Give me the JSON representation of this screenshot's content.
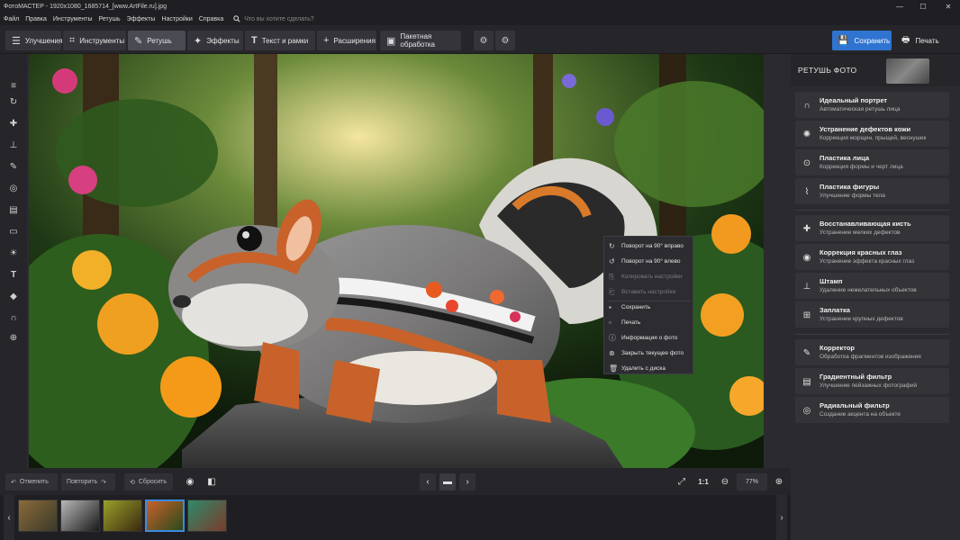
{
  "titlebar": {
    "title": "ФотоМАСТЕР - 1920x1080_1685714_[www.ArtFile.ru].jpg",
    "minimize": "—",
    "maximize": "☐",
    "close": "✕"
  },
  "menubar": {
    "items": [
      "Файл",
      "Правка",
      "Инструменты",
      "Ретушь",
      "Эффекты",
      "Настройки",
      "Справка"
    ],
    "search_placeholder": "Что вы хотите сделать?"
  },
  "toolbar": {
    "tabs": [
      {
        "label": "Улучшения",
        "icon": "sliders-icon"
      },
      {
        "label": "Инструменты",
        "icon": "crop-icon"
      },
      {
        "label": "Ретушь",
        "icon": "brush-icon"
      },
      {
        "label": "Эффекты",
        "icon": "sparkle-icon"
      },
      {
        "label": "Текст и рамки",
        "icon": "text-icon"
      },
      {
        "label": "Расширения",
        "icon": "plus-icon"
      },
      {
        "label": "Пакетная обработка",
        "icon": "batch-icon"
      }
    ],
    "active_tab": "Ретушь",
    "save_label": "Сохранить",
    "print_label": "Печать",
    "accent_color": "#2f74d0"
  },
  "context_menu": {
    "items": [
      {
        "label": "Поворот на 90° вправо",
        "icon": "rotate-right-icon",
        "enabled": true
      },
      {
        "label": "Поворот на 90° влево",
        "icon": "rotate-left-icon",
        "enabled": true
      },
      {
        "label": "Копировать настройки",
        "icon": "copy-icon",
        "enabled": false
      },
      {
        "label": "Вставить настройки",
        "icon": "paste-icon",
        "enabled": false
      },
      {
        "label": "Сохранить",
        "icon": "save-icon",
        "enabled": true
      },
      {
        "label": "Печать",
        "icon": "print-icon",
        "enabled": true
      },
      {
        "label": "Информация о фото",
        "icon": "info-icon",
        "enabled": true
      },
      {
        "label": "Закрыть текущее фото",
        "icon": "close-circle-icon",
        "enabled": true
      },
      {
        "label": "Удалить с диска",
        "icon": "trash-icon",
        "enabled": true
      }
    ]
  },
  "right_panel": {
    "title": "РЕТУШЬ ФОТО",
    "groups": [
      [
        {
          "title": "Идеальный портрет",
          "subtitle": "Автоматическая ретушь лица",
          "icon": "portrait-icon"
        },
        {
          "title": "Устранение дефектов кожи",
          "subtitle": "Коррекция морщин, прыщей, веснушек",
          "icon": "skin-icon"
        },
        {
          "title": "Пластика лица",
          "subtitle": "Коррекция формы и черт лица",
          "icon": "face-icon"
        },
        {
          "title": "Пластика фигуры",
          "subtitle": "Улучшение формы тела",
          "icon": "figure-icon"
        }
      ],
      [
        {
          "title": "Восстанавливающая кисть",
          "subtitle": "Устранение мелких дефектов",
          "icon": "bandage-icon"
        },
        {
          "title": "Коррекция красных глаз",
          "subtitle": "Устранение эффекта красных глаз",
          "icon": "eye-icon"
        },
        {
          "title": "Штамп",
          "subtitle": "Удаление нежелательных объектов",
          "icon": "stamp-icon"
        },
        {
          "title": "Заплатка",
          "subtitle": "Устранение крупных дефектов",
          "icon": "patch-icon"
        }
      ],
      [
        {
          "title": "Корректор",
          "subtitle": "Обработка фрагментов изображения",
          "icon": "corrector-icon"
        },
        {
          "title": "Градиентный фильтр",
          "subtitle": "Улучшение пейзажных фотографий",
          "icon": "gradient-icon"
        },
        {
          "title": "Радиальный фильтр",
          "subtitle": "Создание акцента на объекте",
          "icon": "radial-icon"
        }
      ]
    ]
  },
  "bottom_bar": {
    "undo_label": "Отменить",
    "redo_label": "Повторить",
    "reset_label": "Сбросить",
    "ratio_label": "1:1",
    "zoom": "77%"
  },
  "filmstrip": {
    "thumbs": [
      {
        "name": "tiger",
        "color1": "#8a6a3a",
        "color2": "#3b3a2a"
      },
      {
        "name": "white-tiger",
        "color1": "#b8b8b8",
        "color2": "#1a1a1a"
      },
      {
        "name": "birds",
        "color1": "#9aa02a",
        "color2": "#3a2a10"
      },
      {
        "name": "squirrel",
        "color1": "#c8622a",
        "color2": "#2a4a1c",
        "selected": true
      },
      {
        "name": "forest",
        "color1": "#2e8a6a",
        "color2": "#7a3a2a"
      }
    ]
  }
}
